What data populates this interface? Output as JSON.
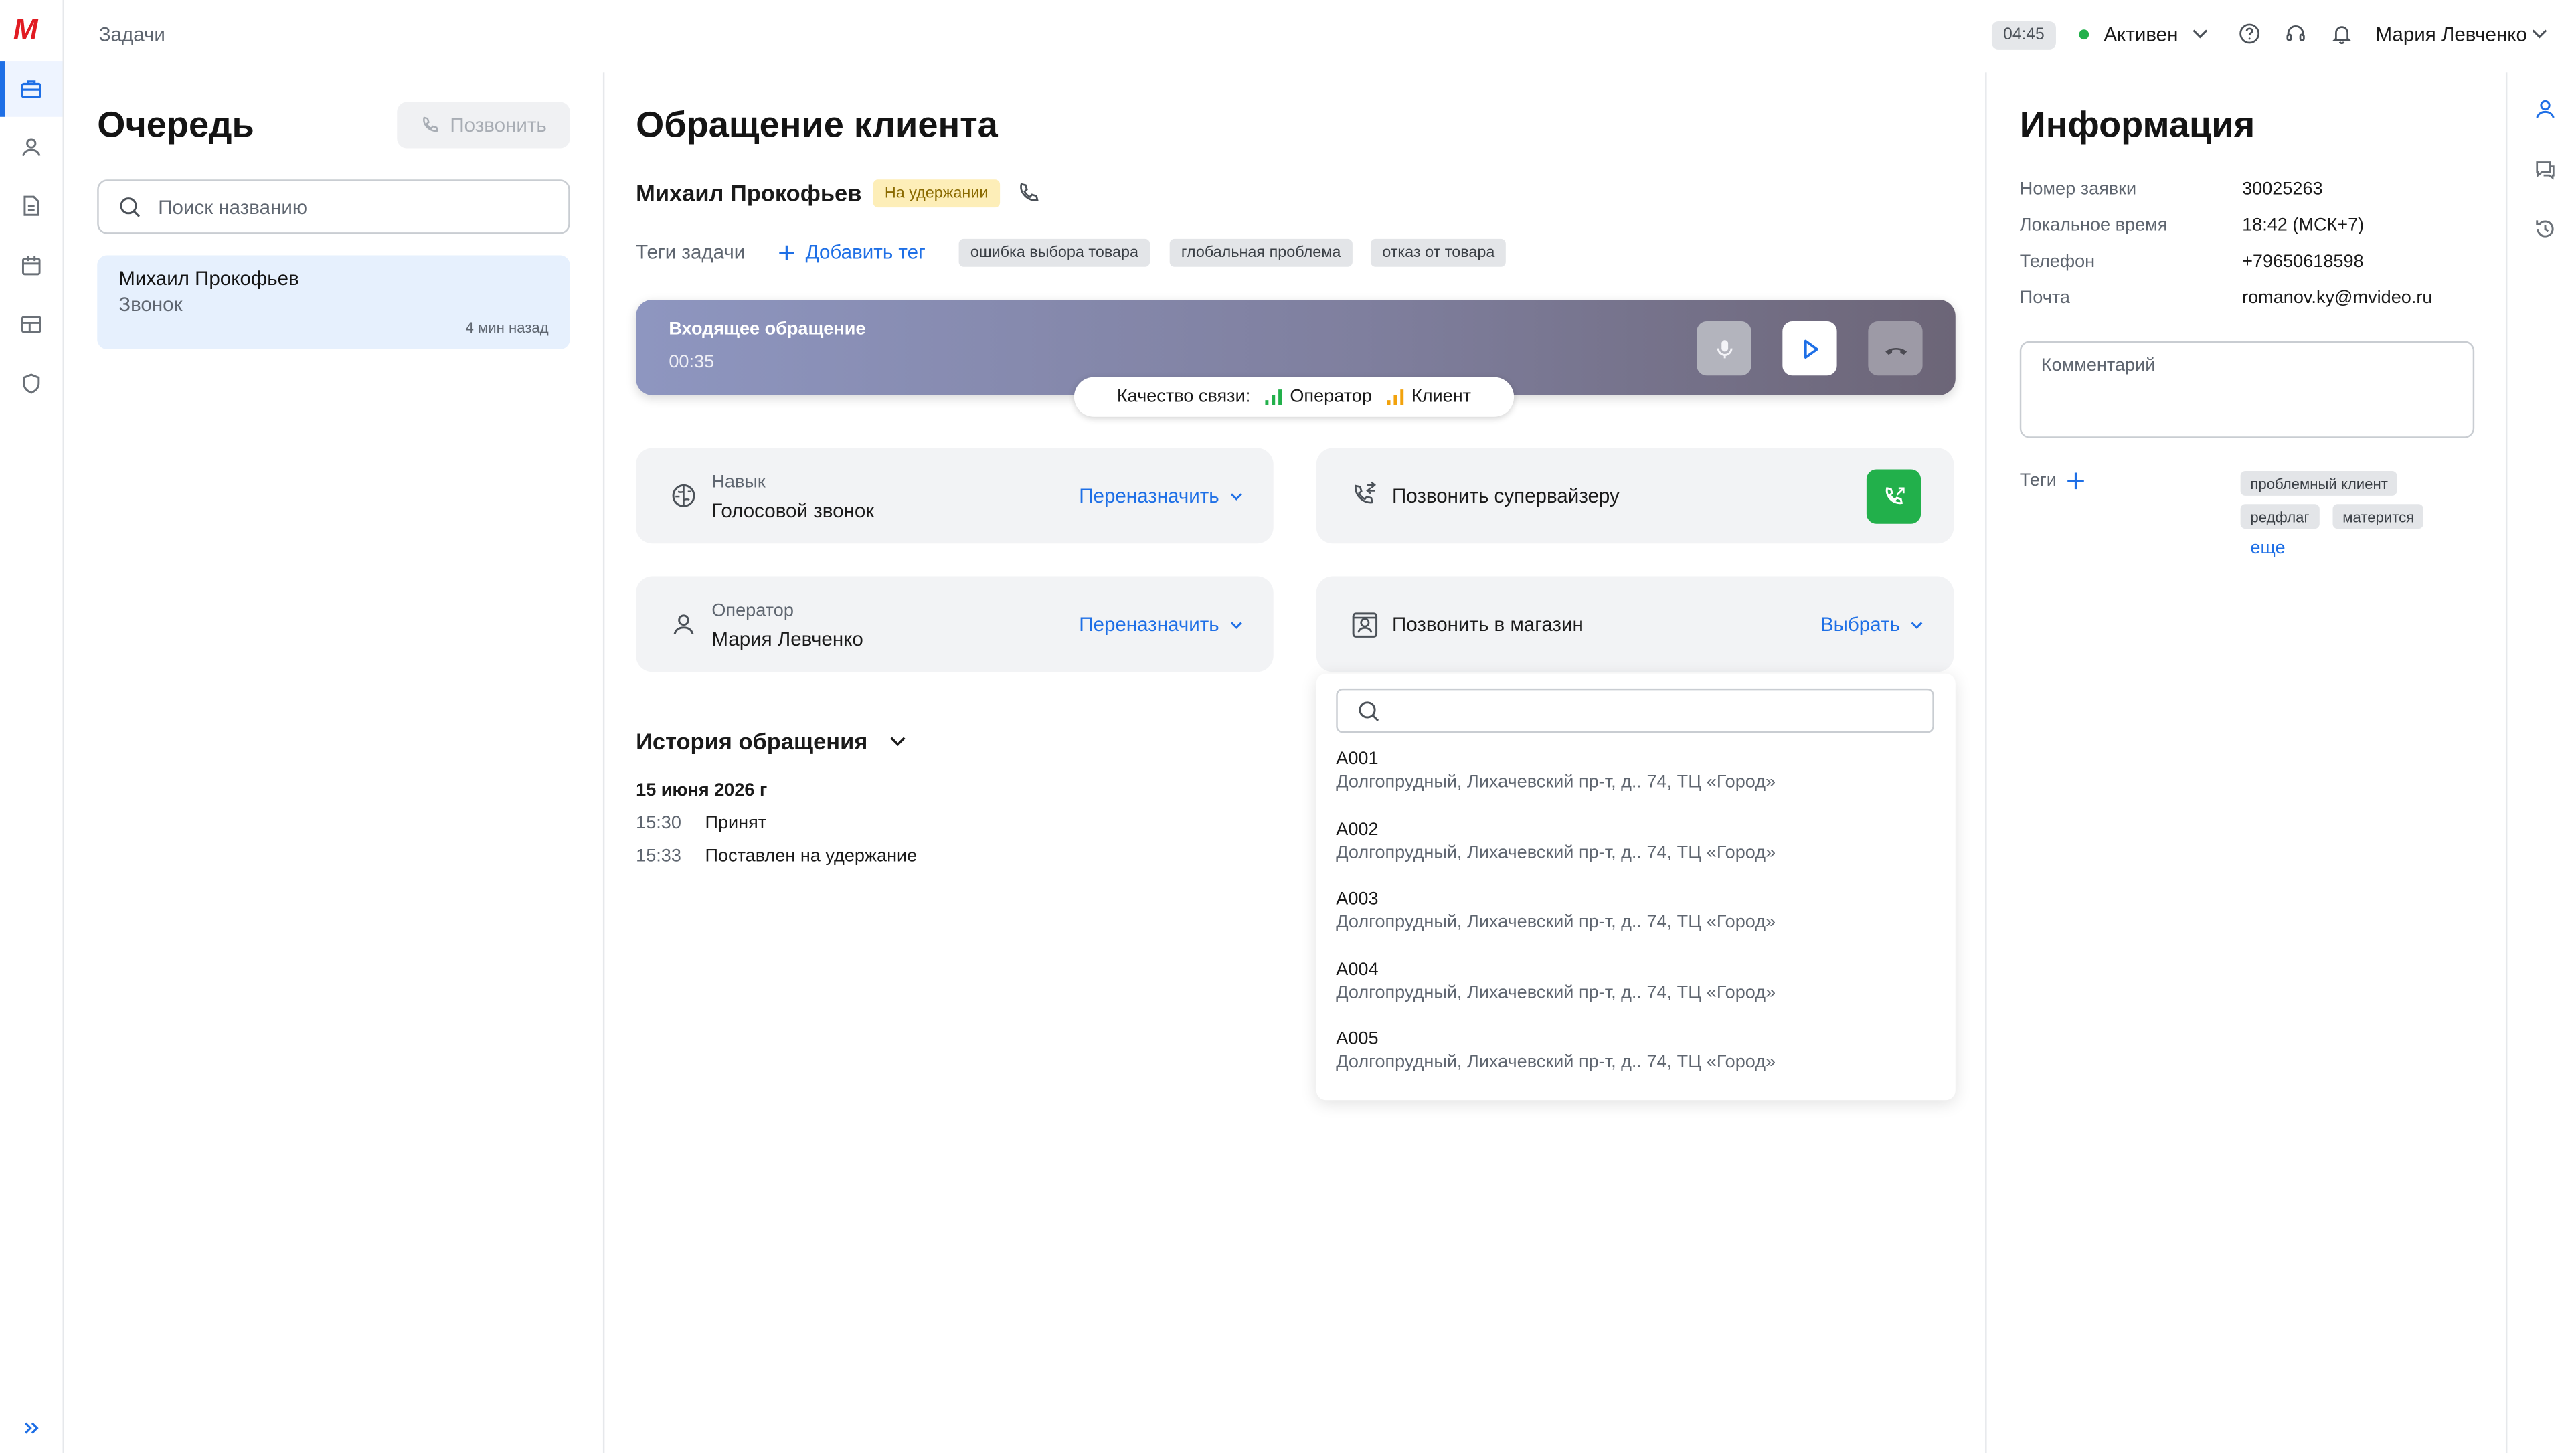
{
  "app": {
    "logo": "М",
    "section_title": "Задачи"
  },
  "topbar": {
    "timer": "04:45",
    "status": "Активен",
    "status_color": "#22b04b",
    "user_name": "Мария Левченко",
    "icons": [
      "help-icon",
      "headset-icon",
      "bell-icon"
    ]
  },
  "sidebar": {
    "items": [
      {
        "name": "briefcase-icon",
        "active": true
      },
      {
        "name": "user-icon",
        "active": false
      },
      {
        "name": "document-icon",
        "active": false
      },
      {
        "name": "calendar-icon",
        "active": false
      },
      {
        "name": "table-icon",
        "active": false
      },
      {
        "name": "shield-icon",
        "active": false
      }
    ],
    "expand_icon": "double-chevron-right-icon"
  },
  "queue": {
    "title": "Очередь",
    "call_button": "Позвонить",
    "search_placeholder": "Поиск названию",
    "items": [
      {
        "name": "Михаил Прокофьев",
        "type": "Звонок",
        "time": "4 мин назад"
      }
    ]
  },
  "case": {
    "title": "Обращение клиента",
    "client_name": "Михаил Прокофьев",
    "status_badge": "На удержании",
    "tags_label": "Теги задачи",
    "add_tag": "Добавить тег",
    "tags": [
      "ошибка выбора товара",
      "глобальная проблема",
      "отказ от товара"
    ],
    "call": {
      "title": "Входящее обращение",
      "duration": "00:35",
      "quality_label": "Качество связи:",
      "quality_operator": "Оператор",
      "quality_client": "Клиент"
    },
    "skill": {
      "label": "Навык",
      "value": "Голосовой звонок",
      "action": "Переназначить"
    },
    "operator": {
      "label": "Оператор",
      "value": "Мария Левченко",
      "action": "Переназначить"
    },
    "supervisor": {
      "label": "Позвонить супервайзеру"
    },
    "store": {
      "label": "Позвонить в магазин",
      "action": "Выбрать"
    },
    "history": {
      "title": "История обращения",
      "date": "15 июня 2026 г",
      "events": [
        {
          "time": "15:30",
          "text": "Принят"
        },
        {
          "time": "15:33",
          "text": "Поставлен на удержание"
        }
      ]
    }
  },
  "store_dropdown": {
    "search_value": "",
    "items": [
      {
        "code": "A001",
        "address": "Долгопрудный, Лихачевский пр-т, д.. 74, ТЦ «Город»"
      },
      {
        "code": "A002",
        "address": "Долгопрудный, Лихачевский пр-т, д.. 74, ТЦ «Город»"
      },
      {
        "code": "A003",
        "address": "Долгопрудный, Лихачевский пр-т, д.. 74, ТЦ «Город»"
      },
      {
        "code": "A004",
        "address": "Долгопрудный, Лихачевский пр-т, д.. 74, ТЦ «Город»"
      },
      {
        "code": "A005",
        "address": "Долгопрудный, Лихачевский пр-т, д.. 74, ТЦ «Город»"
      }
    ]
  },
  "info": {
    "title": "Информация",
    "fields": [
      {
        "label": "Номер заявки",
        "value": "30025263"
      },
      {
        "label": "Локальное время",
        "value": "18:42 (МСК+7)"
      },
      {
        "label": "Телефон",
        "value": "+79650618598"
      },
      {
        "label": "Почта",
        "value": "romanov.ky@mvideo.ru"
      }
    ],
    "comment_placeholder": "Комментарий",
    "tags_label": "Теги",
    "tags": [
      "проблемный клиент",
      "редфлаг",
      "матерится"
    ],
    "more": "еще"
  },
  "right_rail": [
    "profile-icon",
    "chat-icon",
    "history-icon"
  ],
  "colors": {
    "accent": "#1e6fe6",
    "success": "#22b04b",
    "hold_badge": "#fdeeb8",
    "brand": "#e11b22"
  }
}
